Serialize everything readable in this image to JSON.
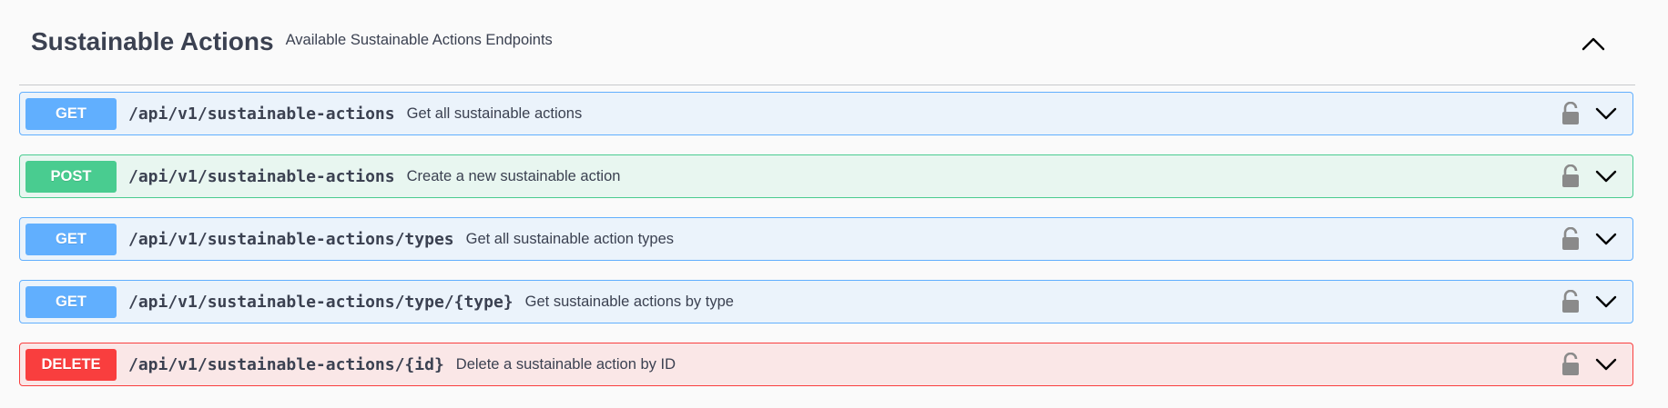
{
  "section": {
    "title": "Sustainable Actions",
    "description": "Available Sustainable Actions Endpoints"
  },
  "operations": [
    {
      "method": "GET",
      "path": "/api/v1/sustainable-actions",
      "summary": "Get all sustainable actions"
    },
    {
      "method": "POST",
      "path": "/api/v1/sustainable-actions",
      "summary": "Create a new sustainable action"
    },
    {
      "method": "GET",
      "path": "/api/v1/sustainable-actions/types",
      "summary": "Get all sustainable action types"
    },
    {
      "method": "GET",
      "path": "/api/v1/sustainable-actions/type/{type}",
      "summary": "Get sustainable actions by type"
    },
    {
      "method": "DELETE",
      "path": "/api/v1/sustainable-actions/{id}",
      "summary": "Delete a sustainable action by ID"
    }
  ],
  "icons": {
    "collapse": "chevron-up-icon",
    "lock": "unlocked-lock-icon",
    "expand": "chevron-down-icon"
  },
  "colors": {
    "get": "#61affe",
    "post": "#49cc90",
    "delete": "#f93e3e",
    "text": "#3b4151"
  }
}
